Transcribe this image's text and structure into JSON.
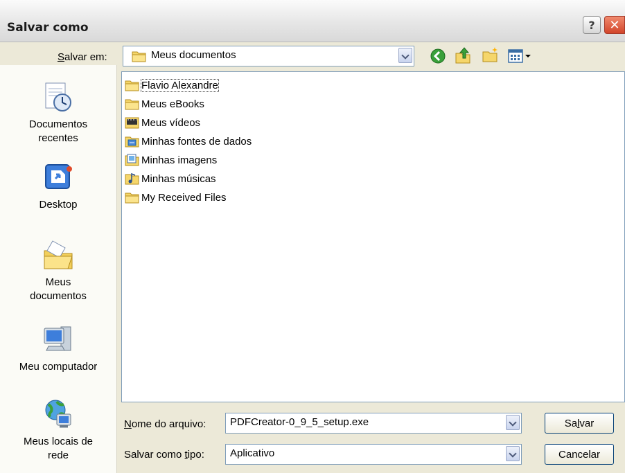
{
  "window": {
    "title": "Salvar como",
    "help": "?",
    "close": "✕"
  },
  "toolbar": {
    "location_label_hotkey": "S",
    "location_label_rest": "alvar em:",
    "location_value": "Meus documentos"
  },
  "places": [
    {
      "label": "Documentos recentes",
      "icon": "recent-documents-icon"
    },
    {
      "label": "Desktop",
      "icon": "desktop-icon"
    },
    {
      "label": "Meus documentos",
      "icon": "my-documents-icon"
    },
    {
      "label": "Meu computador",
      "icon": "my-computer-icon"
    },
    {
      "label": "Meus locais de rede",
      "icon": "network-places-icon"
    }
  ],
  "files": [
    {
      "name": "Flavio Alexandre",
      "icon": "folder-icon"
    },
    {
      "name": "Meus eBooks",
      "icon": "folder-icon"
    },
    {
      "name": "Meus vídeos",
      "icon": "video-folder-icon"
    },
    {
      "name": "Minhas fontes de dados",
      "icon": "data-sources-folder-icon"
    },
    {
      "name": "Minhas imagens",
      "icon": "pictures-folder-icon"
    },
    {
      "name": "Minhas músicas",
      "icon": "music-folder-icon"
    },
    {
      "name": "My Received Files",
      "icon": "folder-icon"
    }
  ],
  "form": {
    "filename_label_hotkey": "N",
    "filename_label_rest": "ome do arquivo:",
    "filename_value": "PDFCreator-0_9_5_setup.exe",
    "type_label_prefix": "Salvar como ",
    "type_label_hotkey": "t",
    "type_label_rest": "ipo:",
    "type_value": "Aplicativo"
  },
  "buttons": {
    "save_pre": "Sa",
    "save_hotkey": "l",
    "save_post": "var",
    "cancel": "Cancelar"
  }
}
